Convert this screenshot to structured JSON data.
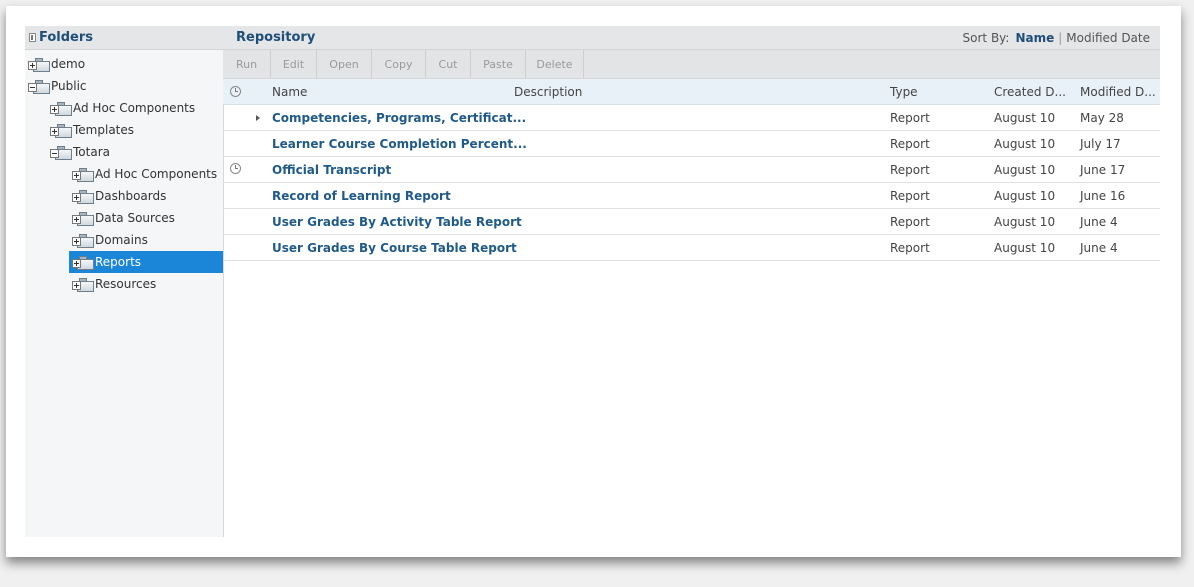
{
  "folders": {
    "title": "Folders",
    "tree": [
      {
        "label": "demo",
        "expanded": false,
        "selected": false
      },
      {
        "label": "Public",
        "expanded": true,
        "selected": false
      },
      {
        "label": "Ad Hoc Components",
        "expanded": false,
        "selected": false
      },
      {
        "label": "Templates",
        "expanded": false,
        "selected": false
      },
      {
        "label": "Totara",
        "expanded": true,
        "selected": false
      },
      {
        "label": "Ad Hoc Components",
        "expanded": false,
        "selected": false
      },
      {
        "label": "Dashboards",
        "expanded": false,
        "selected": false
      },
      {
        "label": "Data Sources",
        "expanded": false,
        "selected": false
      },
      {
        "label": "Domains",
        "expanded": false,
        "selected": false
      },
      {
        "label": "Reports",
        "expanded": false,
        "selected": true
      },
      {
        "label": "Resources",
        "expanded": false,
        "selected": false
      }
    ]
  },
  "repository": {
    "title": "Repository",
    "sort": {
      "label": "Sort By:",
      "options": [
        "Name",
        "Modified Date"
      ],
      "active": "Name"
    },
    "toolbar": [
      "Run",
      "Edit",
      "Open",
      "Copy",
      "Cut",
      "Paste",
      "Delete"
    ],
    "columns": {
      "name": "Name",
      "description": "Description",
      "type": "Type",
      "created": "Created D...",
      "modified": "Modified D..."
    },
    "rows": [
      {
        "name": "Competencies, Programs, Certificat...",
        "description": "",
        "type": "Report",
        "created": "August 10",
        "modified": "May 28",
        "expandable": true,
        "scheduled": false
      },
      {
        "name": "Learner Course Completion Percent...",
        "description": "",
        "type": "Report",
        "created": "August 10",
        "modified": "July 17",
        "expandable": false,
        "scheduled": false
      },
      {
        "name": "Official Transcript",
        "description": "",
        "type": "Report",
        "created": "August 10",
        "modified": "June 17",
        "expandable": false,
        "scheduled": true
      },
      {
        "name": "Record of Learning Report",
        "description": "",
        "type": "Report",
        "created": "August 10",
        "modified": "June 16",
        "expandable": false,
        "scheduled": false
      },
      {
        "name": "User Grades By Activity Table Report",
        "description": "",
        "type": "Report",
        "created": "August 10",
        "modified": "June 4",
        "expandable": false,
        "scheduled": false
      },
      {
        "name": "User Grades By Course Table Report",
        "description": "",
        "type": "Report",
        "created": "August 10",
        "modified": "June 4",
        "expandable": false,
        "scheduled": false
      }
    ]
  },
  "colors": {
    "accent": "#1f4e79",
    "selection": "#1b86d8"
  }
}
